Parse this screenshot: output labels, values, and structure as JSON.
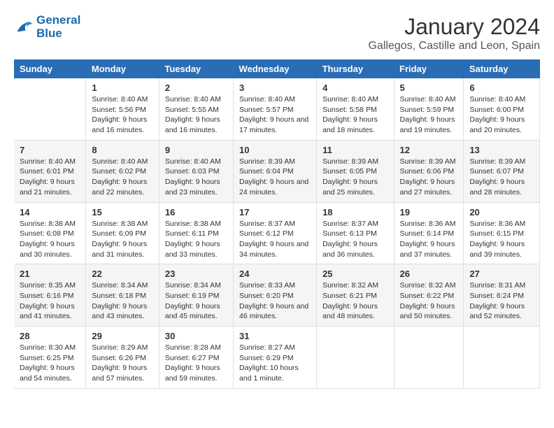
{
  "logo": {
    "line1": "General",
    "line2": "Blue"
  },
  "title": "January 2024",
  "subtitle": "Gallegos, Castille and Leon, Spain",
  "headers": [
    "Sunday",
    "Monday",
    "Tuesday",
    "Wednesday",
    "Thursday",
    "Friday",
    "Saturday"
  ],
  "weeks": [
    [
      {
        "day": "",
        "sunrise": "",
        "sunset": "",
        "daylight": ""
      },
      {
        "day": "1",
        "sunrise": "Sunrise: 8:40 AM",
        "sunset": "Sunset: 5:56 PM",
        "daylight": "Daylight: 9 hours and 16 minutes."
      },
      {
        "day": "2",
        "sunrise": "Sunrise: 8:40 AM",
        "sunset": "Sunset: 5:55 AM",
        "daylight": "Daylight: 9 hours and 16 minutes."
      },
      {
        "day": "3",
        "sunrise": "Sunrise: 8:40 AM",
        "sunset": "Sunset: 5:57 PM",
        "daylight": "Daylight: 9 hours and 17 minutes."
      },
      {
        "day": "4",
        "sunrise": "Sunrise: 8:40 AM",
        "sunset": "Sunset: 5:58 PM",
        "daylight": "Daylight: 9 hours and 18 minutes."
      },
      {
        "day": "5",
        "sunrise": "Sunrise: 8:40 AM",
        "sunset": "Sunset: 5:59 PM",
        "daylight": "Daylight: 9 hours and 19 minutes."
      },
      {
        "day": "6",
        "sunrise": "Sunrise: 8:40 AM",
        "sunset": "Sunset: 6:00 PM",
        "daylight": "Daylight: 9 hours and 20 minutes."
      }
    ],
    [
      {
        "day": "7",
        "sunrise": "Sunrise: 8:40 AM",
        "sunset": "Sunset: 6:01 PM",
        "daylight": "Daylight: 9 hours and 21 minutes."
      },
      {
        "day": "8",
        "sunrise": "Sunrise: 8:40 AM",
        "sunset": "Sunset: 6:02 PM",
        "daylight": "Daylight: 9 hours and 22 minutes."
      },
      {
        "day": "9",
        "sunrise": "Sunrise: 8:40 AM",
        "sunset": "Sunset: 6:03 PM",
        "daylight": "Daylight: 9 hours and 23 minutes."
      },
      {
        "day": "10",
        "sunrise": "Sunrise: 8:39 AM",
        "sunset": "Sunset: 6:04 PM",
        "daylight": "Daylight: 9 hours and 24 minutes."
      },
      {
        "day": "11",
        "sunrise": "Sunrise: 8:39 AM",
        "sunset": "Sunset: 6:05 PM",
        "daylight": "Daylight: 9 hours and 25 minutes."
      },
      {
        "day": "12",
        "sunrise": "Sunrise: 8:39 AM",
        "sunset": "Sunset: 6:06 PM",
        "daylight": "Daylight: 9 hours and 27 minutes."
      },
      {
        "day": "13",
        "sunrise": "Sunrise: 8:39 AM",
        "sunset": "Sunset: 6:07 PM",
        "daylight": "Daylight: 9 hours and 28 minutes."
      }
    ],
    [
      {
        "day": "14",
        "sunrise": "Sunrise: 8:38 AM",
        "sunset": "Sunset: 6:08 PM",
        "daylight": "Daylight: 9 hours and 30 minutes."
      },
      {
        "day": "15",
        "sunrise": "Sunrise: 8:38 AM",
        "sunset": "Sunset: 6:09 PM",
        "daylight": "Daylight: 9 hours and 31 minutes."
      },
      {
        "day": "16",
        "sunrise": "Sunrise: 8:38 AM",
        "sunset": "Sunset: 6:11 PM",
        "daylight": "Daylight: 9 hours and 33 minutes."
      },
      {
        "day": "17",
        "sunrise": "Sunrise: 8:37 AM",
        "sunset": "Sunset: 6:12 PM",
        "daylight": "Daylight: 9 hours and 34 minutes."
      },
      {
        "day": "18",
        "sunrise": "Sunrise: 8:37 AM",
        "sunset": "Sunset: 6:13 PM",
        "daylight": "Daylight: 9 hours and 36 minutes."
      },
      {
        "day": "19",
        "sunrise": "Sunrise: 8:36 AM",
        "sunset": "Sunset: 6:14 PM",
        "daylight": "Daylight: 9 hours and 37 minutes."
      },
      {
        "day": "20",
        "sunrise": "Sunrise: 8:36 AM",
        "sunset": "Sunset: 6:15 PM",
        "daylight": "Daylight: 9 hours and 39 minutes."
      }
    ],
    [
      {
        "day": "21",
        "sunrise": "Sunrise: 8:35 AM",
        "sunset": "Sunset: 6:16 PM",
        "daylight": "Daylight: 9 hours and 41 minutes."
      },
      {
        "day": "22",
        "sunrise": "Sunrise: 8:34 AM",
        "sunset": "Sunset: 6:18 PM",
        "daylight": "Daylight: 9 hours and 43 minutes."
      },
      {
        "day": "23",
        "sunrise": "Sunrise: 8:34 AM",
        "sunset": "Sunset: 6:19 PM",
        "daylight": "Daylight: 9 hours and 45 minutes."
      },
      {
        "day": "24",
        "sunrise": "Sunrise: 8:33 AM",
        "sunset": "Sunset: 6:20 PM",
        "daylight": "Daylight: 9 hours and 46 minutes."
      },
      {
        "day": "25",
        "sunrise": "Sunrise: 8:32 AM",
        "sunset": "Sunset: 6:21 PM",
        "daylight": "Daylight: 9 hours and 48 minutes."
      },
      {
        "day": "26",
        "sunrise": "Sunrise: 8:32 AM",
        "sunset": "Sunset: 6:22 PM",
        "daylight": "Daylight: 9 hours and 50 minutes."
      },
      {
        "day": "27",
        "sunrise": "Sunrise: 8:31 AM",
        "sunset": "Sunset: 6:24 PM",
        "daylight": "Daylight: 9 hours and 52 minutes."
      }
    ],
    [
      {
        "day": "28",
        "sunrise": "Sunrise: 8:30 AM",
        "sunset": "Sunset: 6:25 PM",
        "daylight": "Daylight: 9 hours and 54 minutes."
      },
      {
        "day": "29",
        "sunrise": "Sunrise: 8:29 AM",
        "sunset": "Sunset: 6:26 PM",
        "daylight": "Daylight: 9 hours and 57 minutes."
      },
      {
        "day": "30",
        "sunrise": "Sunrise: 8:28 AM",
        "sunset": "Sunset: 6:27 PM",
        "daylight": "Daylight: 9 hours and 59 minutes."
      },
      {
        "day": "31",
        "sunrise": "Sunrise: 8:27 AM",
        "sunset": "Sunset: 6:29 PM",
        "daylight": "Daylight: 10 hours and 1 minute."
      },
      {
        "day": "",
        "sunrise": "",
        "sunset": "",
        "daylight": ""
      },
      {
        "day": "",
        "sunrise": "",
        "sunset": "",
        "daylight": ""
      },
      {
        "day": "",
        "sunrise": "",
        "sunset": "",
        "daylight": ""
      }
    ]
  ]
}
